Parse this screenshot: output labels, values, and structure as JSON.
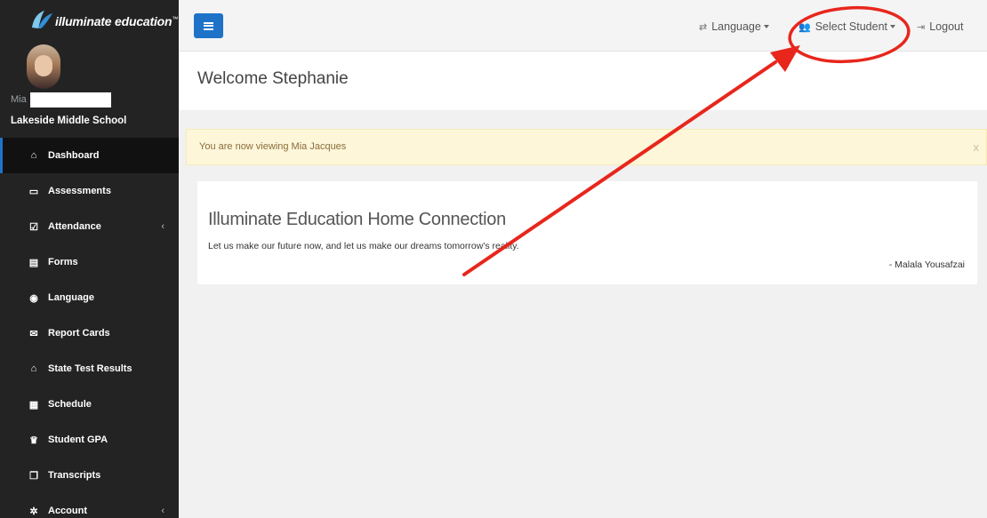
{
  "brand": {
    "name": "illuminate education",
    "tm": "™"
  },
  "profile": {
    "student_first_name": "Mia",
    "school": "Lakeside Middle School"
  },
  "sidebar": {
    "items": [
      {
        "label": "Dashboard",
        "icon": "home-icon",
        "glyph": "⌂"
      },
      {
        "label": "Assessments",
        "icon": "laptop-icon",
        "glyph": "▭"
      },
      {
        "label": "Attendance",
        "icon": "check-square-icon",
        "glyph": "☑",
        "chevron": "‹"
      },
      {
        "label": "Forms",
        "icon": "file-icon",
        "glyph": "▤"
      },
      {
        "label": "Language",
        "icon": "globe-icon",
        "glyph": "◉"
      },
      {
        "label": "Report Cards",
        "icon": "envelope-icon",
        "glyph": "✉"
      },
      {
        "label": "State Test Results",
        "icon": "bank-icon",
        "glyph": "⌂"
      },
      {
        "label": "Schedule",
        "icon": "calendar-icon",
        "glyph": "▦"
      },
      {
        "label": "Student GPA",
        "icon": "trophy-icon",
        "glyph": "♛"
      },
      {
        "label": "Transcripts",
        "icon": "copy-icon",
        "glyph": "❐"
      },
      {
        "label": "Account",
        "icon": "gear-icon",
        "glyph": "✲",
        "chevron": "‹"
      }
    ]
  },
  "topbar": {
    "language_label": "Language",
    "select_student_label": "Select Student",
    "logout_label": "Logout"
  },
  "welcome": {
    "title": "Welcome Stephanie"
  },
  "alert": {
    "message": "You are now viewing Mia Jacques",
    "close": "x"
  },
  "card": {
    "title": "Illuminate Education Home Connection",
    "quote": "Let us make our future now, and let us make our dreams tomorrow's reality.",
    "author": "- Malala Yousafzai"
  },
  "colors": {
    "accent": "#1e73c9",
    "sidebar_bg": "#232323",
    "alert_bg": "#fdf6d9",
    "annotation": "#e8261c"
  }
}
